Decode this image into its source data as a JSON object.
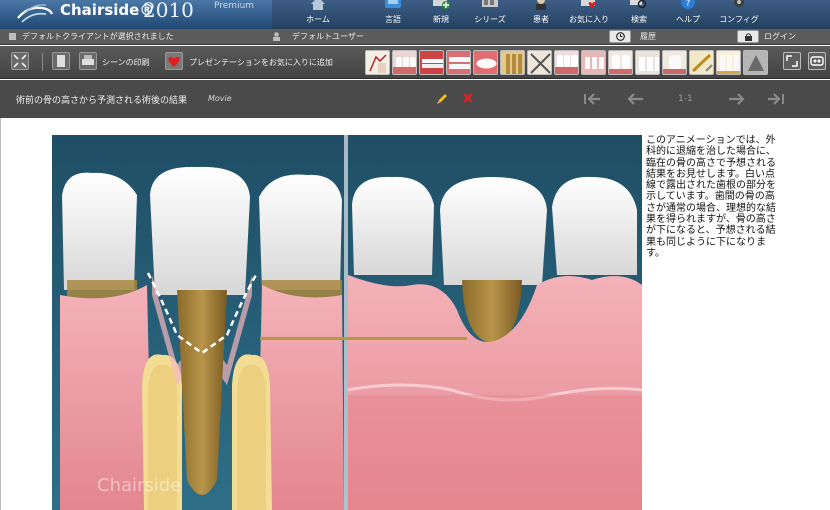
{
  "brand": {
    "name": "Chairside®",
    "year": "2010",
    "edition": "Premium"
  },
  "nav": [
    {
      "label": "ホーム",
      "icon": "house-icon"
    },
    {
      "label": "言語",
      "icon": "language-icon"
    },
    {
      "label": "新規",
      "icon": "new-icon"
    },
    {
      "label": "シリーズ",
      "icon": "series-icon"
    },
    {
      "label": "患者",
      "icon": "patient-icon"
    },
    {
      "label": "お気に入り",
      "icon": "favorites-icon"
    },
    {
      "label": "検索",
      "icon": "search-icon"
    },
    {
      "label": "ヘルプ",
      "icon": "help-icon"
    },
    {
      "label": "コンフィグ",
      "icon": "config-icon"
    }
  ],
  "status": {
    "client": "デフォルトクライアントが選択されました",
    "user": "デフォルトユーザー",
    "history": "履歴",
    "login": "ログイン"
  },
  "toolbar": {
    "print_label": "シーンの印刷",
    "favorite_label": "プレゼンテーションをお気に入りに追加"
  },
  "title": {
    "text": "術前の骨の高さから予測される術後の結果",
    "type": "Movie",
    "page": "1-1"
  },
  "movie": {
    "watermark": "Chairside"
  },
  "description": "このアニメーションでは、外科的に退縮を治した場合に、臨在の骨の高さで予想される結果をお見せします。白い点線で露出された歯根の部分を示しています。歯間の骨の高さが通常の場合、理想的な結果を得られますが、骨の高さが下になると、予想される結果も同じように下になります。",
  "colors": {
    "nav_bg": "#2c4b70",
    "accent_red": "#e02020",
    "gum_pink": "#e89ca4",
    "tooth_white": "#f2f2f2",
    "root_tan": "#a88740"
  }
}
